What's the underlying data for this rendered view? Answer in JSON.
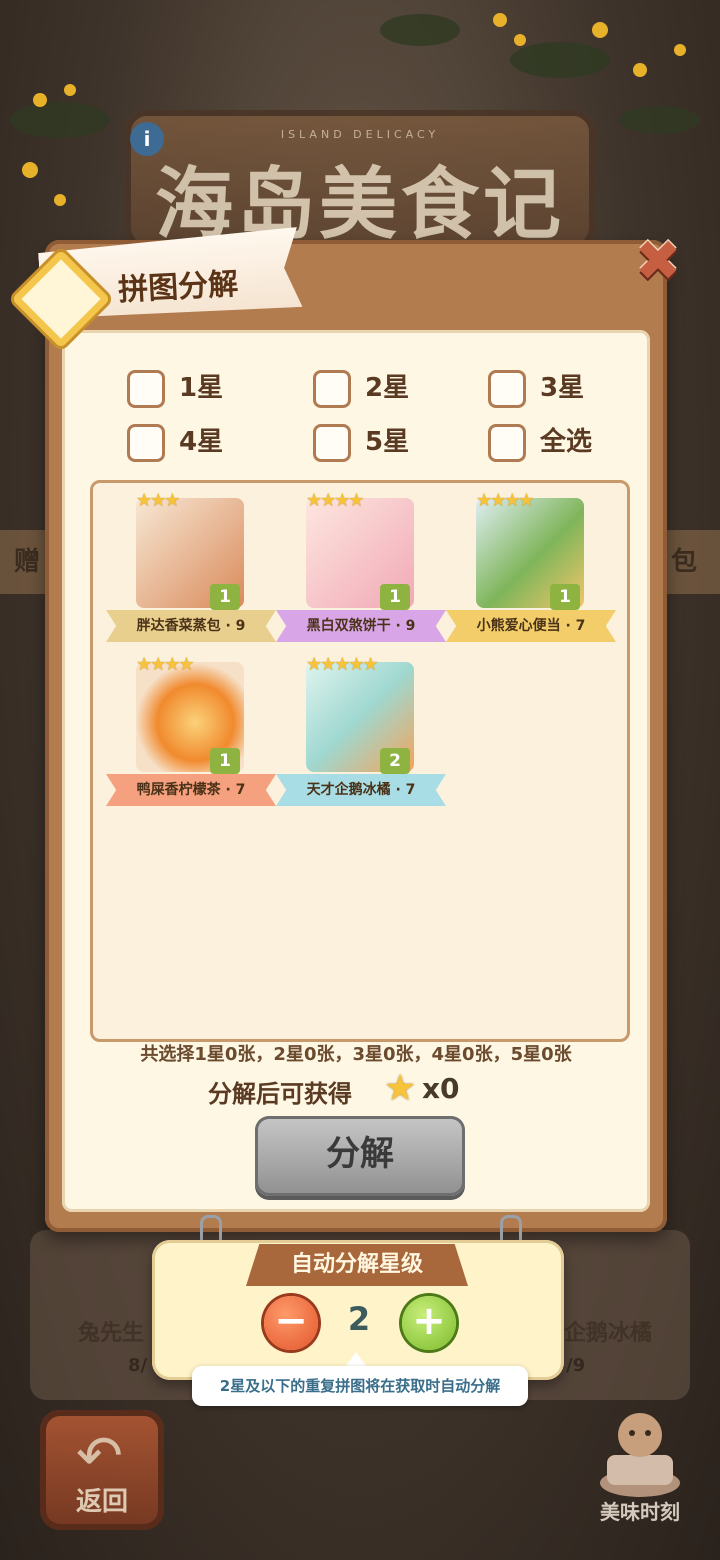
{
  "background": {
    "title": "海岛美食记",
    "subtitle": "ISLAND DELICACY",
    "info_icon": "i",
    "side_left": "赠",
    "side_right": "包",
    "lower_left_label": "兔先生",
    "lower_right_label": "企鹅冰橘",
    "lower_left_count": "8/",
    "lower_right_count": "/9",
    "back_label": "返回",
    "moment_label": "美味时刻"
  },
  "dialog": {
    "title": "拼图分解",
    "close_icon": "close-x",
    "filters": [
      {
        "label": "1星",
        "checked": false
      },
      {
        "label": "2星",
        "checked": false
      },
      {
        "label": "3星",
        "checked": false
      },
      {
        "label": "4星",
        "checked": false
      },
      {
        "label": "5星",
        "checked": false
      },
      {
        "label": "全选",
        "checked": false
      }
    ],
    "cards": [
      {
        "stars": "★★★",
        "count": "1",
        "name": "胖达香菜蒸包 · 9",
        "ribbon_color": "#e9cf8e",
        "art_color": "#d98a5a"
      },
      {
        "stars": "★★★★",
        "count": "1",
        "name": "黑白双煞饼干 · 9",
        "ribbon_color": "#d8a6e6",
        "art_color": "#f1a9b6"
      },
      {
        "stars": "★★★★",
        "count": "1",
        "name": "小熊爱心便当 · 7",
        "ribbon_color": "#f2cd6a",
        "art_color": "#7fb55a"
      },
      {
        "stars": "★★★★",
        "count": "1",
        "name": "鸭屎香柠檬茶 · 7",
        "ribbon_color": "#f5a07e",
        "art_color": "#f18a2e"
      },
      {
        "stars": "★★★★★",
        "count": "2",
        "name": "天才企鹅冰橘 · 7",
        "ribbon_color": "#a9dde6",
        "art_color": "#9fd8d0"
      }
    ],
    "summary": "共选择1星0张，2星0张，3星0张，4星0张，5星0张",
    "gain_label": "分解后可获得",
    "gain_icon": "star-icon",
    "gain_value": "x0",
    "decompose_label": "分解"
  },
  "auto": {
    "title": "自动分解星级",
    "minus": "−",
    "plus": "+",
    "level": "2",
    "hint": "2星及以下的重复拼图将在获取时自动分解"
  }
}
